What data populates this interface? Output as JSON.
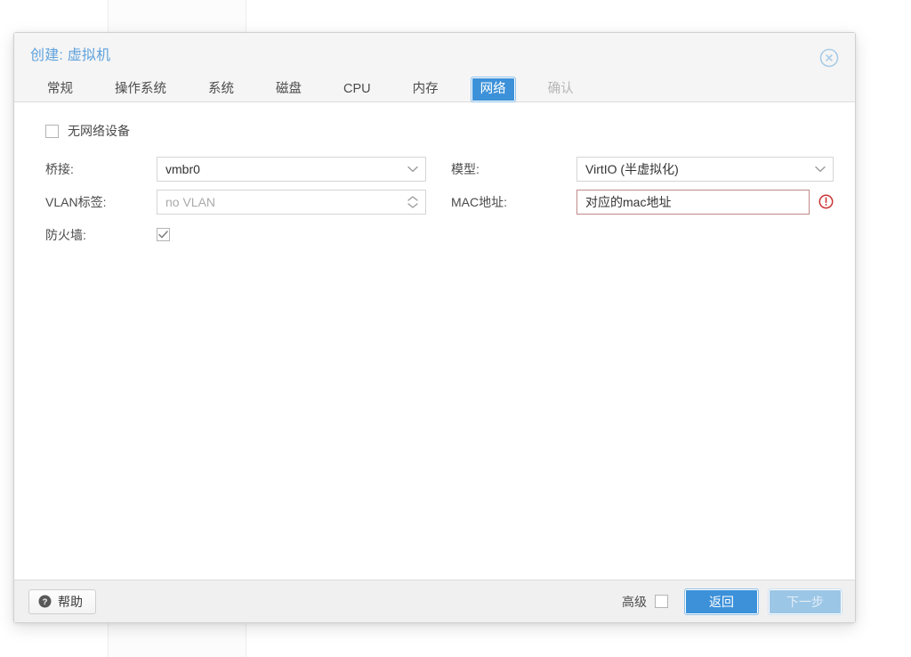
{
  "dialog": {
    "title": "创建: 虚拟机",
    "close_icon": "close-circle-icon"
  },
  "tabs": [
    {
      "label": "常规",
      "state": "normal"
    },
    {
      "label": "操作系统",
      "state": "normal"
    },
    {
      "label": "系统",
      "state": "normal"
    },
    {
      "label": "磁盘",
      "state": "normal"
    },
    {
      "label": "CPU",
      "state": "normal"
    },
    {
      "label": "内存",
      "state": "normal"
    },
    {
      "label": "网络",
      "state": "active"
    },
    {
      "label": "确认",
      "state": "disabled"
    }
  ],
  "form": {
    "no_network_device": {
      "label": "无网络设备",
      "checked": false
    },
    "left": {
      "bridge": {
        "label": "桥接:",
        "value": "vmbr0",
        "icon": "chevron-down-icon"
      },
      "vlan_tag": {
        "label": "VLAN标签:",
        "placeholder": "no VLAN",
        "value": "",
        "icon": "spinner-updown-icon"
      },
      "firewall": {
        "label": "防火墙:",
        "checked": true
      }
    },
    "right": {
      "model": {
        "label": "模型:",
        "value": "VirtIO (半虚拟化)",
        "icon": "chevron-down-icon"
      },
      "mac_address": {
        "label": "MAC地址:",
        "value": "对应的mac地址",
        "invalid": true,
        "error_icon": "error-exclamation-icon"
      }
    }
  },
  "footer": {
    "help_label": "帮助",
    "help_icon": "question-mark-icon",
    "advanced_label": "高级",
    "advanced_checked": false,
    "back_label": "返回",
    "next_label": "下一步"
  },
  "colors": {
    "accent_blue": "#3c91d9",
    "title_blue": "#5fa2dd",
    "error_red": "#cc3333",
    "error_border": "#c08a8a",
    "disabled_blue": "#9cc6e6"
  }
}
